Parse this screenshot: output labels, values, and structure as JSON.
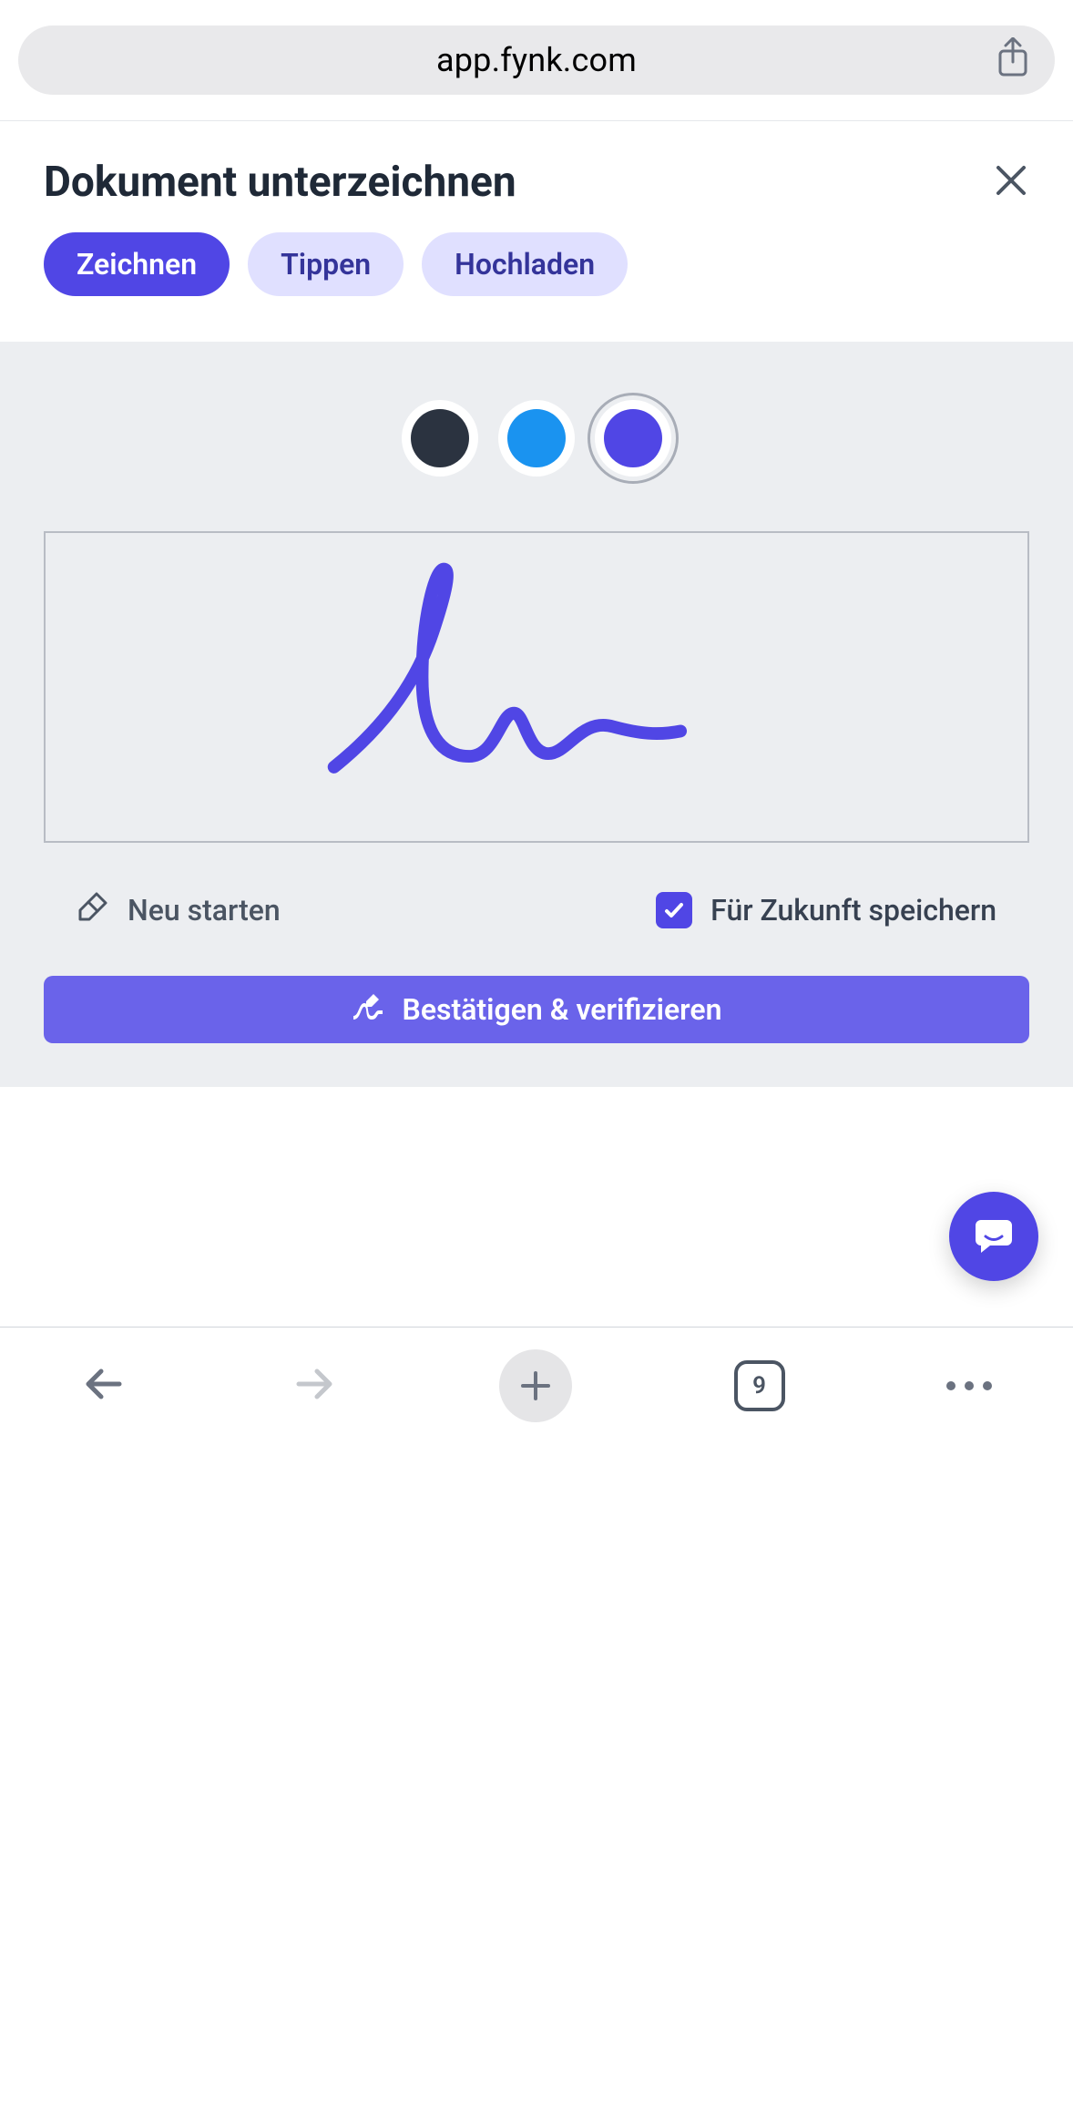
{
  "browser": {
    "url": "app.fynk.com",
    "tab_count": "9"
  },
  "modal": {
    "title": "Dokument unterzeichnen",
    "tabs": [
      {
        "label": "Zeichnen",
        "active": true
      },
      {
        "label": "Tippen",
        "active": false
      },
      {
        "label": "Hochladen",
        "active": false
      }
    ]
  },
  "signature": {
    "colors": [
      {
        "hex": "#2b3340",
        "selected": false
      },
      {
        "hex": "#1a93f0",
        "selected": false
      },
      {
        "hex": "#5046e5",
        "selected": true
      }
    ],
    "stroke_color": "#5046e5"
  },
  "actions": {
    "restart_label": "Neu starten",
    "save_future_label": "Für Zukunft speichern",
    "save_future_checked": true,
    "confirm_label": "Bestätigen & verifizieren"
  },
  "icons": {
    "share": "share-icon",
    "close": "close-icon",
    "eraser": "eraser-icon",
    "check": "check-icon",
    "signature": "signature-icon",
    "chat": "chat-icon",
    "back": "back-arrow-icon",
    "forward": "forward-arrow-icon",
    "plus": "plus-icon",
    "more": "more-icon"
  }
}
